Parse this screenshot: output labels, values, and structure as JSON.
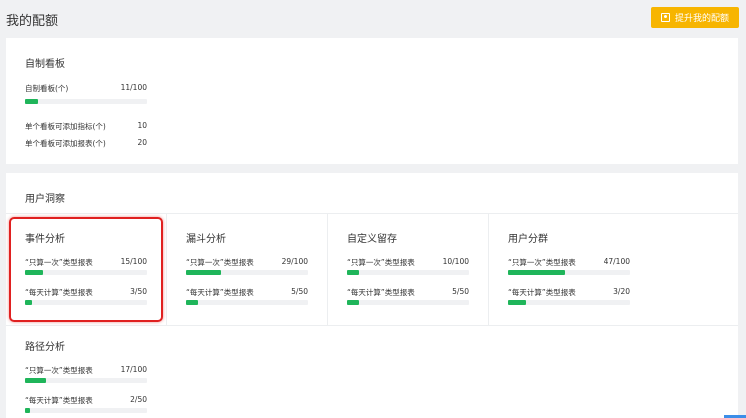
{
  "header": {
    "title": "我的配额",
    "upgrade_label": "提升我的配额"
  },
  "dashboards": {
    "title": "自制看板",
    "items": [
      {
        "label": "自制看板(个)",
        "value": "11/100",
        "progress": 0.11
      },
      {
        "label": "单个看板可添加指标(个)",
        "value": "10"
      },
      {
        "label": "单个看板可添加报表(个)",
        "value": "20"
      }
    ]
  },
  "insights": {
    "title": "用户洞察",
    "modules": [
      {
        "title": "事件分析",
        "rows": [
          {
            "label": "“只算一次”类型报表",
            "value": "15/100",
            "progress": 0.15
          },
          {
            "label": "“每天计算”类型报表",
            "value": "3/50",
            "progress": 0.06
          }
        ]
      },
      {
        "title": "漏斗分析",
        "rows": [
          {
            "label": "“只算一次”类型报表",
            "value": "29/100",
            "progress": 0.29
          },
          {
            "label": "“每天计算”类型报表",
            "value": "5/50",
            "progress": 0.1
          }
        ]
      },
      {
        "title": "自定义留存",
        "rows": [
          {
            "label": "“只算一次”类型报表",
            "value": "10/100",
            "progress": 0.1
          },
          {
            "label": "“每天计算”类型报表",
            "value": "5/50",
            "progress": 0.1
          }
        ]
      },
      {
        "title": "用户分群",
        "rows": [
          {
            "label": "“只算一次”类型报表",
            "value": "47/100",
            "progress": 0.47
          },
          {
            "label": "“每天计算”类型报表",
            "value": "3/20",
            "progress": 0.15
          }
        ]
      },
      {
        "title": "路径分析",
        "rows": [
          {
            "label": "“只算一次”类型报表",
            "value": "17/100",
            "progress": 0.17
          },
          {
            "label": "“每天计算”类型报表",
            "value": "2/50",
            "progress": 0.04
          }
        ]
      }
    ]
  },
  "colors": {
    "accent": "#f7b500",
    "progress": "#1fb55a",
    "highlight": "#e02020"
  }
}
